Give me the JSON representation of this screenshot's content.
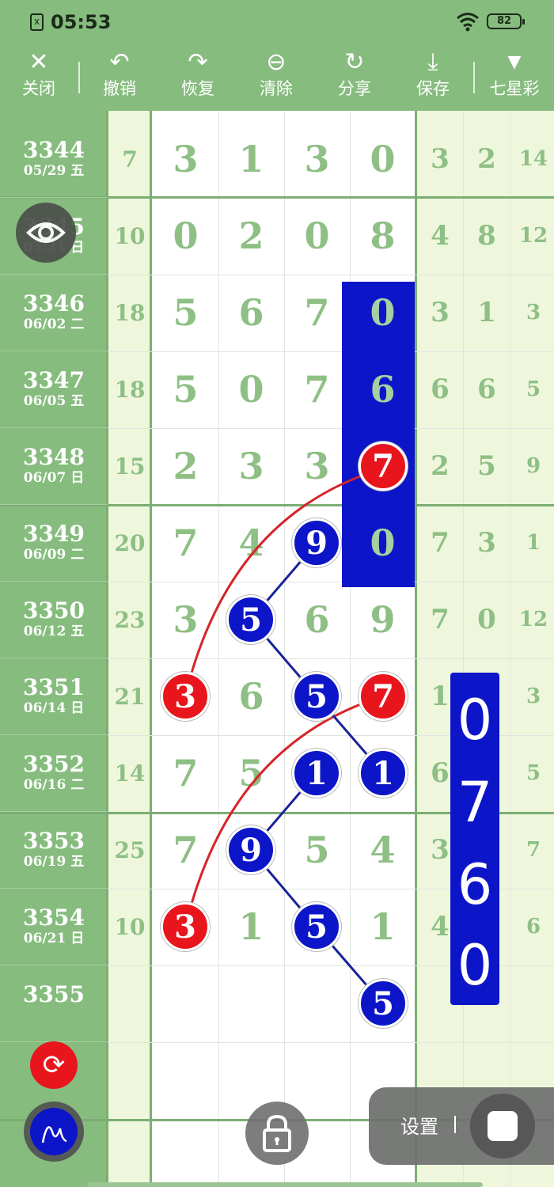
{
  "status_bar": {
    "time": "05:53",
    "notification_icon": "x",
    "battery": "82"
  },
  "toolbar": {
    "items": [
      {
        "label": "关闭",
        "icon": "close-icon",
        "glyph": "✕"
      },
      {
        "label": "撤销",
        "icon": "undo-icon",
        "glyph": "↶"
      },
      {
        "label": "恢复",
        "icon": "redo-icon",
        "glyph": "↷"
      },
      {
        "label": "清除",
        "icon": "clear-icon",
        "glyph": "⊖"
      },
      {
        "label": "分享",
        "icon": "share-icon",
        "glyph": "↻"
      },
      {
        "label": "保存",
        "icon": "download-icon",
        "glyph": "⤓"
      },
      {
        "label": "七星彩",
        "icon": "dropdown-icon",
        "glyph": "▼"
      }
    ]
  },
  "rows": [
    {
      "period": "3344",
      "date": "05/29 五",
      "sum": "7",
      "digits": [
        "3",
        "1",
        "3",
        "0"
      ],
      "right": [
        "3",
        "2",
        "14"
      ]
    },
    {
      "period": "3345",
      "date": "05/31 日",
      "sum": "10",
      "digits": [
        "0",
        "2",
        "0",
        "8"
      ],
      "right": [
        "4",
        "8",
        "12"
      ]
    },
    {
      "period": "3346",
      "date": "06/02 二",
      "sum": "18",
      "digits": [
        "5",
        "6",
        "7",
        "0"
      ],
      "right": [
        "3",
        "1",
        "3"
      ]
    },
    {
      "period": "3347",
      "date": "06/05 五",
      "sum": "18",
      "digits": [
        "5",
        "0",
        "7",
        "6"
      ],
      "right": [
        "6",
        "6",
        "5"
      ]
    },
    {
      "period": "3348",
      "date": "06/07 日",
      "sum": "15",
      "digits": [
        "2",
        "3",
        "3",
        "7"
      ],
      "right": [
        "2",
        "5",
        "9"
      ]
    },
    {
      "period": "3349",
      "date": "06/09 二",
      "sum": "20",
      "digits": [
        "7",
        "4",
        "9",
        "0"
      ],
      "right": [
        "7",
        "3",
        "1"
      ]
    },
    {
      "period": "3350",
      "date": "06/12 五",
      "sum": "23",
      "digits": [
        "3",
        "5",
        "6",
        "9"
      ],
      "right": [
        "7",
        "0",
        "12"
      ]
    },
    {
      "period": "3351",
      "date": "06/14 日",
      "sum": "21",
      "digits": [
        "3",
        "6",
        "5",
        "7"
      ],
      "right": [
        "1",
        "",
        "3"
      ]
    },
    {
      "period": "3352",
      "date": "06/16 二",
      "sum": "14",
      "digits": [
        "7",
        "5",
        "1",
        "1"
      ],
      "right": [
        "6",
        "",
        "5"
      ]
    },
    {
      "period": "3353",
      "date": "06/19 五",
      "sum": "25",
      "digits": [
        "7",
        "9",
        "5",
        "4"
      ],
      "right": [
        "3",
        "",
        "7"
      ]
    },
    {
      "period": "3354",
      "date": "06/21 日",
      "sum": "10",
      "digits": [
        "3",
        "1",
        "5",
        "1"
      ],
      "right": [
        "4",
        "",
        "6"
      ]
    },
    {
      "period": "3355",
      "date": "",
      "sum": "",
      "digits": [
        "",
        "",
        "",
        "5"
      ],
      "right": [
        "",
        "",
        ""
      ]
    }
  ],
  "side_digits": [
    "0",
    "7",
    "6",
    "0"
  ],
  "controls": {
    "settings_label": "设置",
    "eye_icon": "eye-icon",
    "refresh_icon": "refresh-icon",
    "pen_icon": "pen-icon",
    "lock_icon": "lock-icon",
    "record_icon": "stop-icon"
  },
  "colors": {
    "header_green": "#86bc7e",
    "ball_red": "#e8161c",
    "ball_blue": "#0c16c8",
    "digit_green": "#8ebf84",
    "pale_column": "#eef7dc"
  }
}
